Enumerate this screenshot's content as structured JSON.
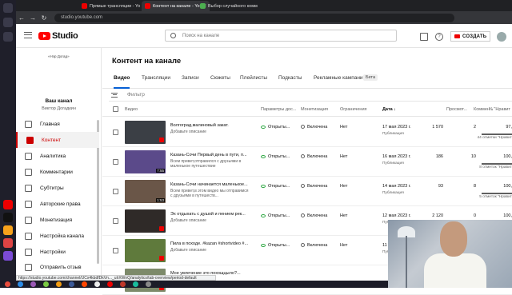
{
  "browser": {
    "tabs": [
      {
        "label": "Прямые трансляции - Yo",
        "active": false
      },
      {
        "label": "Контент на канале - Yo",
        "active": true
      },
      {
        "label": "Выбор случайного комм",
        "active": false
      }
    ],
    "url": "studio.youtube.com",
    "status_url": "https://studio.youtube.com/channel/UCx4kbdfDkVn..._ulrXWnQ/analytics/tab-overview/period-default"
  },
  "header": {
    "logo_text": "Studio",
    "search_placeholder": "Поиск на канале",
    "create_label": "СОЗДАТЬ"
  },
  "sidebar": {
    "avatar_label": "«Нэр Догад»",
    "channel_title": "Ваш канал",
    "channel_owner": "Виктор Догадкин",
    "items": [
      {
        "label": "Главная",
        "active": false
      },
      {
        "label": "Контент",
        "active": true
      },
      {
        "label": "Аналитика",
        "active": false
      },
      {
        "label": "Комментарии",
        "active": false
      },
      {
        "label": "Субтитры",
        "active": false
      },
      {
        "label": "Авторские права",
        "active": false
      },
      {
        "label": "Монетизация",
        "active": false
      },
      {
        "label": "Настройка канала",
        "active": false
      },
      {
        "label": "Настройки",
        "active": false
      },
      {
        "label": "Отправить отзыв",
        "active": false
      }
    ]
  },
  "main": {
    "title": "Контент на канале",
    "tabs": [
      "Видео",
      "Трансляции",
      "Записи",
      "Сюжеты",
      "Плейлисты",
      "Подкасты",
      "Рекламные кампании"
    ],
    "beta_label": "Бета",
    "filter_placeholder": "Фильтр",
    "columns": [
      "Видео",
      "Параметры дос...",
      "Монетизация",
      "Ограничения",
      "Дата",
      "Просмот...",
      "Коммен...",
      "% \"Нравит"
    ],
    "rows": [
      {
        "title": "Волгоград,малиновый закат.",
        "desc": "Добавьте описание",
        "duration": "",
        "access": "Открыты...",
        "monet": "Включена",
        "restr": "Нет",
        "date": "17 мая 2023 г.",
        "date_sub": "Публикация",
        "views": "1 570",
        "comments": "2",
        "likes": "97,",
        "likes_sub": "44 отметки \"Нравит",
        "thumb_color": "#3b3f45"
      },
      {
        "title": "Казань-Сочи Первый день в пути, п...",
        "desc": "Всем привет,отправился с друзьями в маленькое путешествие",
        "duration": "7:55",
        "access": "Открыты...",
        "monet": "Включена",
        "restr": "Нет",
        "date": "16 мая 2023 г.",
        "date_sub": "Публикация",
        "views": "186",
        "comments": "10",
        "likes": "100,",
        "likes_sub": "8 отметок \"Нравит",
        "thumb_color": "#5b4a8a"
      },
      {
        "title": "Казань-Сочи начинается маленькое...",
        "desc": "Всем привет,в этом видео мы отправимся с друзьями в путешеств...",
        "duration": "1:53",
        "access": "Открыты...",
        "monet": "Включена",
        "restr": "Нет",
        "date": "14 мая 2023 г.",
        "date_sub": "Публикация",
        "views": "93",
        "comments": "8",
        "likes": "100,",
        "likes_sub": "5 отметок \"Нравит",
        "thumb_color": "#6a5648"
      },
      {
        "title": "Эх отдыхать с душой и пением рек...",
        "desc": "Добавьте описание",
        "duration": "",
        "access": "Открыты...",
        "monet": "Включена",
        "restr": "Нет",
        "date": "12 мая 2023 г.",
        "date_sub": "Публикация",
        "views": "2 120",
        "comments": "0",
        "likes": "100,",
        "likes_sub": "",
        "thumb_color": "#2f2a28"
      },
      {
        "title": "Пила в походе. #kazan #shortvideo #...",
        "desc": "Добавьте описание",
        "duration": "",
        "access": "Открыты...",
        "monet": "Включена",
        "restr": "Нет",
        "date": "11 мая 2023 г.",
        "date_sub": "Публикация",
        "views": "",
        "comments": "",
        "likes": "",
        "likes_sub": "",
        "thumb_color": "#5f7a3c"
      },
      {
        "title": "Мое увлечение это похощцыло?...",
        "desc": "",
        "duration": "",
        "access": "",
        "monet": "",
        "restr": "",
        "date": "",
        "date_sub": "",
        "views": "",
        "comments": "",
        "likes": "",
        "likes_sub": "",
        "thumb_color": "#7d8a6a"
      }
    ]
  }
}
